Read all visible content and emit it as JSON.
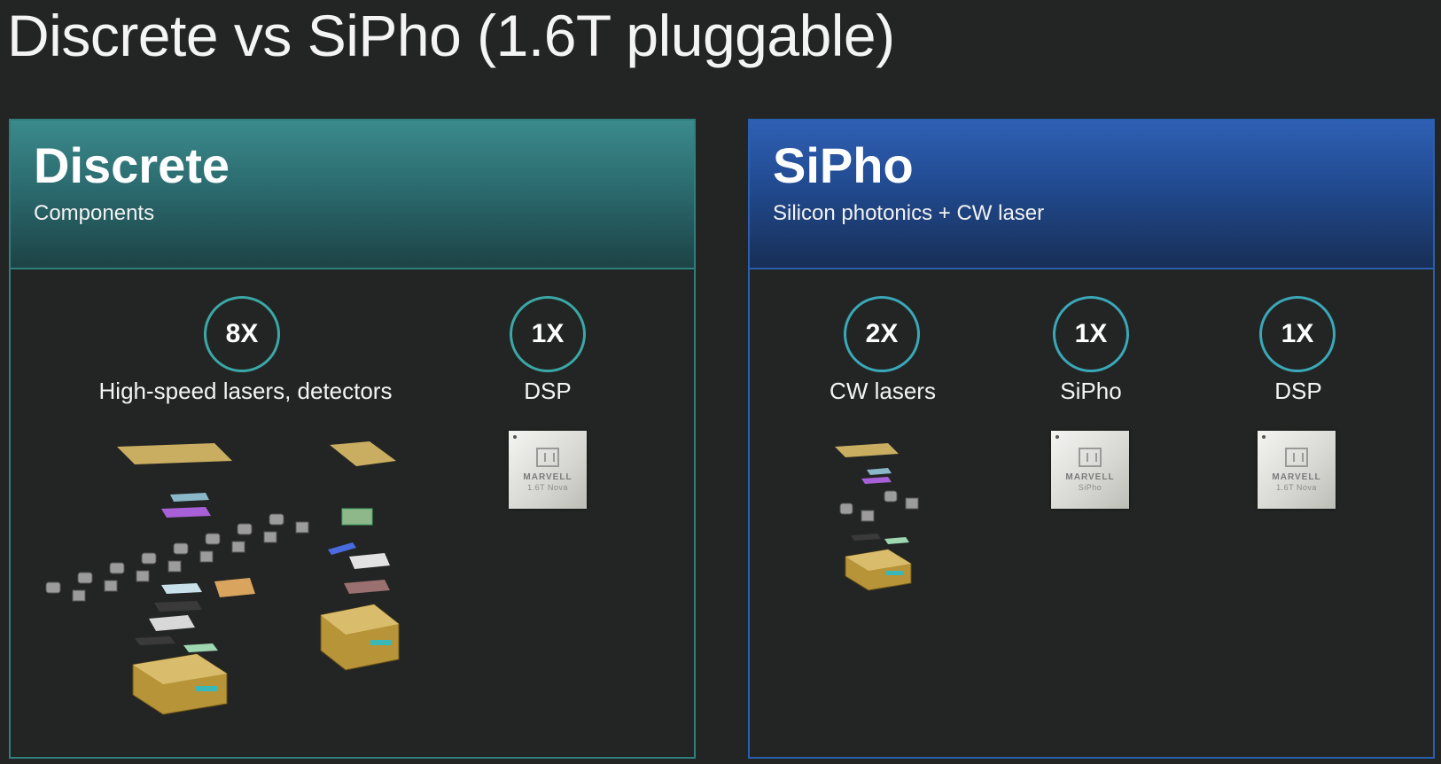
{
  "slide": {
    "title": "Discrete vs SiPho (1.6T pluggable)"
  },
  "discrete": {
    "heading": "Discrete",
    "subheading": "Components",
    "items": [
      {
        "count": "8X",
        "label": "High-speed lasers, detectors"
      },
      {
        "count": "1X",
        "label": "DSP",
        "chip_brand": "MARVELL",
        "chip_model": "1.6T Nova"
      }
    ]
  },
  "sipho": {
    "heading": "SiPho",
    "subheading": "Silicon photonics + CW laser",
    "items": [
      {
        "count": "2X",
        "label": "CW lasers"
      },
      {
        "count": "1X",
        "label": "SiPho",
        "chip_brand": "MARVELL",
        "chip_model": "SiPho"
      },
      {
        "count": "1X",
        "label": "DSP",
        "chip_brand": "MARVELL",
        "chip_model": "1.6T Nova"
      }
    ]
  },
  "colors": {
    "background": "#232524",
    "discrete_accent": "#2f7f7d",
    "sipho_accent": "#2a5fb0",
    "badge_ring": "#3aa8a6"
  }
}
